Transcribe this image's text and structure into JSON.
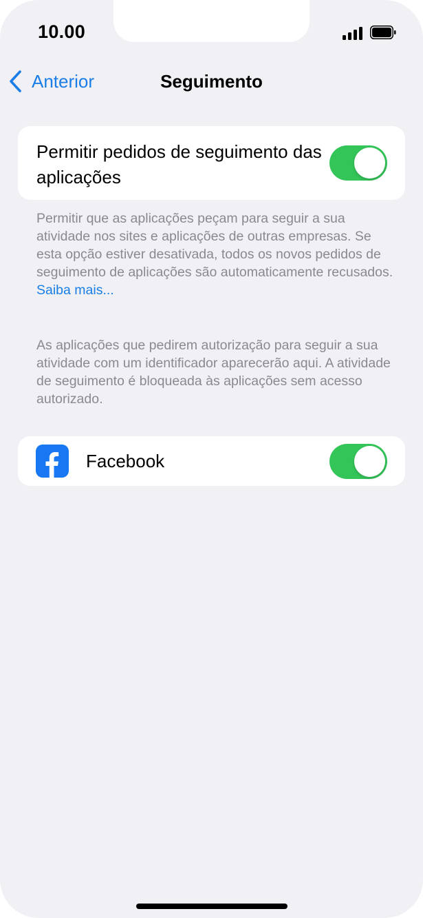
{
  "status_bar": {
    "time": "10.00",
    "signal_icon": "cellular-signal-icon",
    "battery_icon": "battery-icon"
  },
  "nav": {
    "back_icon": "chevron-left-icon",
    "back_label": "Anterior",
    "title": "Seguimento"
  },
  "allow_tracking": {
    "label": "Permitir pedidos de seguimento das aplicações",
    "enabled": true,
    "footnote": "Permitir que as aplicações peçam para seguir a sua atividade nos sites e aplicações de outras empresas. Se esta opção estiver desativada, todos os novos pedidos de seguimento de aplicações são automaticamente recusados. ",
    "learn_more": "Saiba mais..."
  },
  "apps_info": "As aplicações que pedirem autorização para seguir a sua atividade com um identificador aparecerão aqui. A atividade de seguimento é bloqueada às aplicações sem acesso autorizado.",
  "apps": [
    {
      "name": "Facebook",
      "icon": "facebook-icon",
      "enabled": true
    }
  ],
  "colors": {
    "accent": "#1a7ee6",
    "toggle_on": "#34c559",
    "background": "#f0f0f5",
    "secondary_text": "#8a8a8e",
    "facebook_blue": "#1877f2"
  }
}
